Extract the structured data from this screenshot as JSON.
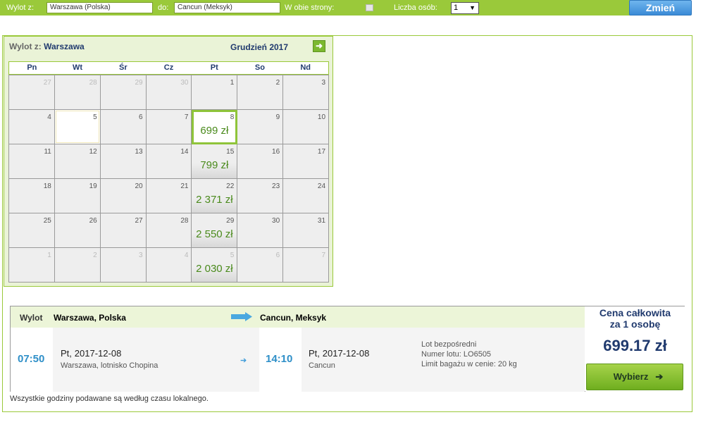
{
  "search": {
    "from_label": "Wylot z:",
    "from_value": "Warszawa (Polska)",
    "to_label": "do:",
    "to_value": "Cancun (Meksyk)",
    "roundtrip_label": "W obie strony:",
    "roundtrip_checked": false,
    "persons_label": "Liczba osób:",
    "persons_value": "1",
    "change_button": "Zmień"
  },
  "calendar": {
    "from_label": "Wylot z:",
    "from_city": "Warszawa",
    "month": "Grudzień 2017",
    "next_icon": "arrow-right-icon",
    "weekdays": [
      "Pn",
      "Wt",
      "Śr",
      "Cz",
      "Pt",
      "So",
      "Nd"
    ],
    "weeks": [
      [
        {
          "d": "27",
          "out": true
        },
        {
          "d": "28",
          "out": true
        },
        {
          "d": "29",
          "out": true
        },
        {
          "d": "30",
          "out": true
        },
        {
          "d": "1"
        },
        {
          "d": "2"
        },
        {
          "d": "3"
        }
      ],
      [
        {
          "d": "4"
        },
        {
          "d": "5",
          "today": true
        },
        {
          "d": "6"
        },
        {
          "d": "7"
        },
        {
          "d": "8",
          "price": "699 zł",
          "selected": true
        },
        {
          "d": "9"
        },
        {
          "d": "10"
        }
      ],
      [
        {
          "d": "11"
        },
        {
          "d": "12"
        },
        {
          "d": "13"
        },
        {
          "d": "14"
        },
        {
          "d": "15",
          "price": "799 zł"
        },
        {
          "d": "16"
        },
        {
          "d": "17"
        }
      ],
      [
        {
          "d": "18"
        },
        {
          "d": "19"
        },
        {
          "d": "20"
        },
        {
          "d": "21"
        },
        {
          "d": "22",
          "price": "2 371 zł"
        },
        {
          "d": "23"
        },
        {
          "d": "24"
        }
      ],
      [
        {
          "d": "25"
        },
        {
          "d": "26"
        },
        {
          "d": "27"
        },
        {
          "d": "28"
        },
        {
          "d": "29",
          "price": "2 550 zł"
        },
        {
          "d": "30"
        },
        {
          "d": "31"
        }
      ],
      [
        {
          "d": "1",
          "out": true
        },
        {
          "d": "2",
          "out": true
        },
        {
          "d": "3",
          "out": true
        },
        {
          "d": "4",
          "out": true
        },
        {
          "d": "5",
          "out": true,
          "price": "2 030 zł"
        },
        {
          "d": "6",
          "out": true
        },
        {
          "d": "7",
          "out": true
        }
      ]
    ]
  },
  "flight": {
    "header_label": "Wylot",
    "from_city": "Warszawa, Polska",
    "to_city": "Cancun, Meksyk",
    "dep_time": "07:50",
    "dep_day": "Pt,",
    "dep_date": "2017-12-08",
    "dep_place": "Warszawa, lotnisko Chopina",
    "arr_time": "14:10",
    "arr_day": "Pt,",
    "arr_date": "2017-12-08",
    "arr_place": "Cancun",
    "info": [
      "Lot bezpośredni",
      "Numer lotu: LO6505",
      "Limit bagażu w cenie: 20 kg"
    ],
    "price_title_1": "Cena całkowita",
    "price_title_2": "za 1 osobę",
    "price": "699.17 zł",
    "choose_button": "Wybierz"
  },
  "note": "Wszystkie godziny podawane są według czasu lokalnego.",
  "colors": {
    "accent_green": "#9ac93a",
    "price_green": "#4a8a1c",
    "navy": "#203a6e",
    "time_blue": "#2e8fc8"
  }
}
